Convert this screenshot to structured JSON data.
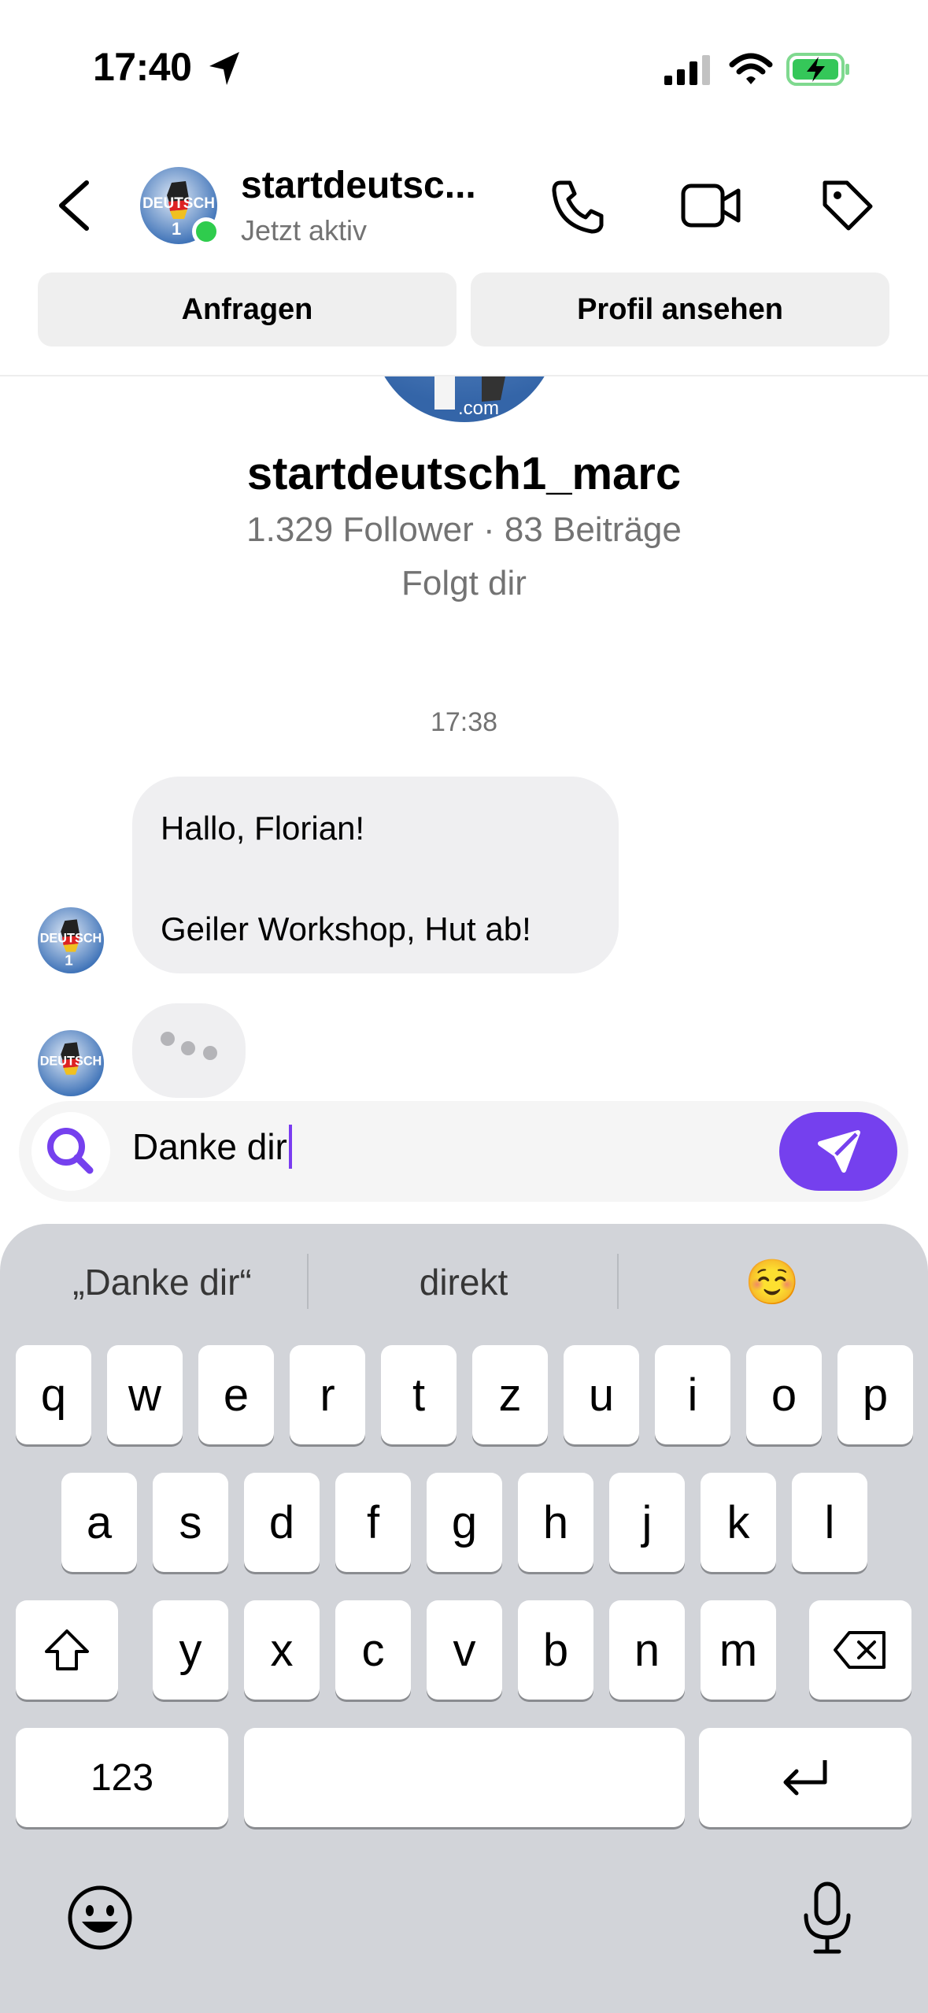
{
  "status_bar": {
    "time": "17:40"
  },
  "header": {
    "name": "startdeutsc...",
    "status": "Jetzt aktiv",
    "request_label": "Anfragen",
    "profile_label": "Profil ansehen"
  },
  "profile": {
    "username": "startdeutsch1_marc",
    "stats": "1.329 Follower · 83 Beiträge",
    "follows_you": "Folgt dir"
  },
  "conversation": {
    "timestamp": "17:38",
    "message_line1": "Hallo, Florian!",
    "message_line2": "Geiler Workshop, Hut ab!"
  },
  "composer": {
    "text": "Danke dir"
  },
  "keyboard": {
    "suggestions": [
      "„Danke dir“",
      "direkt",
      "☺️"
    ],
    "row1": [
      "q",
      "w",
      "e",
      "r",
      "t",
      "z",
      "u",
      "i",
      "o",
      "p"
    ],
    "row2": [
      "a",
      "s",
      "d",
      "f",
      "g",
      "h",
      "j",
      "k",
      "l"
    ],
    "row3": [
      "y",
      "x",
      "c",
      "v",
      "b",
      "n",
      "m"
    ],
    "numbers_label": "123"
  },
  "colors": {
    "accent": "#7540ee",
    "online": "#2fcc4d",
    "battery": "#35c759"
  }
}
